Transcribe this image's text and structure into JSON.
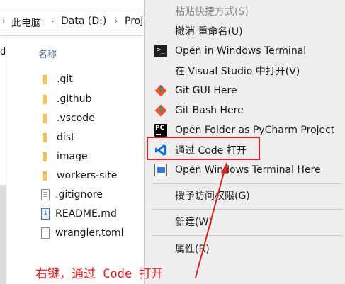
{
  "breadcrumb": {
    "items": [
      "此电脑",
      "Data (D:)",
      "Proj"
    ]
  },
  "sidebar": {
    "fragment": "d"
  },
  "file_list": {
    "column_header": "名称",
    "items": [
      {
        "name": ".git",
        "type": "folder"
      },
      {
        "name": ".github",
        "type": "folder"
      },
      {
        "name": ".vscode",
        "type": "folder"
      },
      {
        "name": "dist",
        "type": "folder"
      },
      {
        "name": "image",
        "type": "folder"
      },
      {
        "name": "workers-site",
        "type": "folder"
      },
      {
        "name": ".gitignore",
        "type": "text-file"
      },
      {
        "name": "README.md",
        "type": "markdown-file"
      },
      {
        "name": "wrangler.toml",
        "type": "file"
      }
    ]
  },
  "context_menu": {
    "items": [
      {
        "label": "粘贴快捷方式(S)",
        "disabled": true,
        "icon": ""
      },
      {
        "label": "撤消 重命名(U)",
        "disabled": false,
        "icon": ""
      },
      {
        "label": "Open in Windows Terminal",
        "disabled": false,
        "icon": "terminal-icon"
      },
      {
        "label": "在 Visual Studio 中打开(V)",
        "disabled": false,
        "icon": ""
      },
      {
        "label": "Git GUI Here",
        "disabled": false,
        "icon": "git-icon"
      },
      {
        "label": "Git Bash Here",
        "disabled": false,
        "icon": "git-icon"
      },
      {
        "label": "Open Folder as PyCharm Project",
        "disabled": false,
        "icon": "pycharm-icon"
      },
      {
        "label": "通过 Code 打开",
        "disabled": false,
        "icon": "vscode-icon"
      },
      {
        "label": "Open Windows Terminal Here",
        "disabled": false,
        "icon": "windows-terminal-icon"
      },
      {
        "label": "授予访问权限(G)",
        "disabled": false,
        "icon": ""
      },
      {
        "label": "新建(W)",
        "disabled": false,
        "icon": ""
      },
      {
        "label": "属性(R)",
        "disabled": false,
        "icon": ""
      }
    ]
  },
  "annotation": {
    "text": "右键，通过 Code 打开",
    "color": "#e02020"
  },
  "colors": {
    "accent_red": "#e02020",
    "vscode_blue": "#0e6fcf",
    "git_orange": "#f05133"
  }
}
